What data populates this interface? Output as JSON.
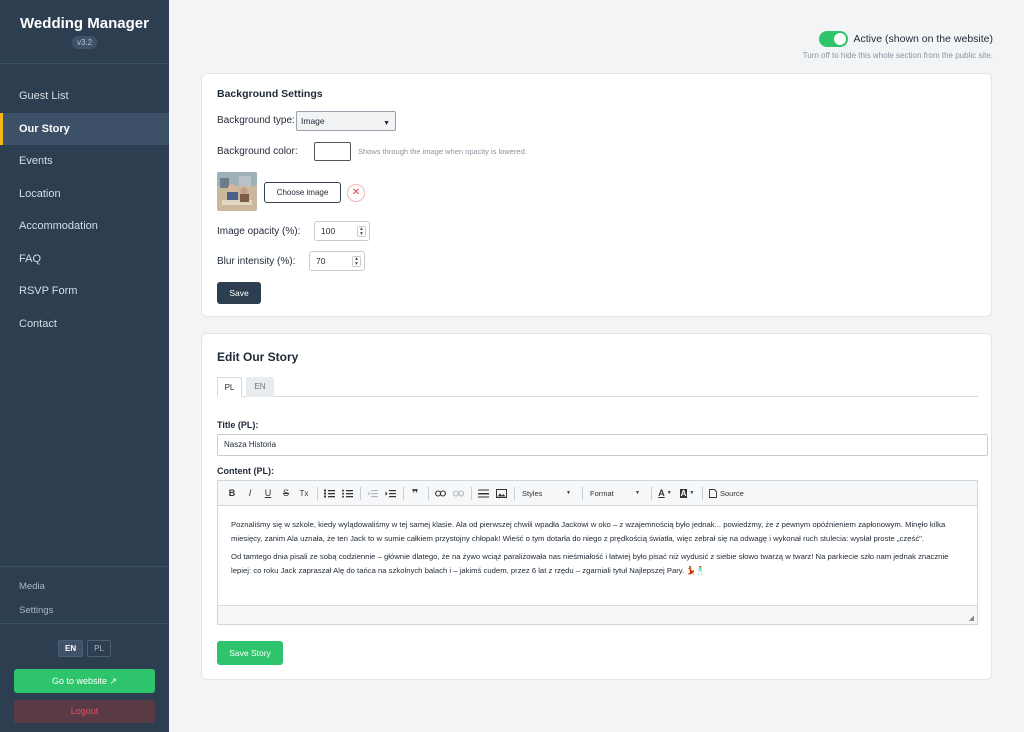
{
  "sidebar": {
    "brand_title": "Wedding Manager",
    "version": "v3.2",
    "nav_items": [
      {
        "label": "Guest List"
      },
      {
        "label": "Our Story"
      },
      {
        "label": "Events"
      },
      {
        "label": "Location"
      },
      {
        "label": "Accommodation"
      },
      {
        "label": "FAQ"
      },
      {
        "label": "RSVP Form"
      },
      {
        "label": "Contact"
      }
    ],
    "active_nav": "Our Story",
    "sub_items": [
      {
        "label": "Media"
      },
      {
        "label": "Settings"
      }
    ],
    "lang": {
      "en": "EN",
      "pl": "PL",
      "active": "EN"
    },
    "go_website_label": "Go to website ↗",
    "logout_label": "Logout"
  },
  "header": {
    "active_label": "Active (shown on the website)",
    "active_on": true,
    "active_hint": "Turn off to hide this whole section from the public site."
  },
  "background_settings": {
    "title": "Background Settings",
    "type_label": "Background type:",
    "type_value": "Image",
    "color_label": "Background color:",
    "color_value": "#ffffff",
    "color_hint": "Shows through the image when opacity is lowered.",
    "choose_image_label": "Choose image",
    "remove_icon": "✕",
    "opacity_label": "Image opacity (%):",
    "opacity_value": "100",
    "blur_label": "Blur intensity (%):",
    "blur_value": "70",
    "save_label": "Save"
  },
  "edit_story": {
    "title": "Edit Our Story",
    "tabs": [
      {
        "label": "PL"
      },
      {
        "label": "EN"
      }
    ],
    "active_tab": "PL",
    "title_field_label": "Title (PL):",
    "title_value": "Nasza Historia",
    "content_label": "Content (PL):",
    "toolbar": {
      "bold": "B",
      "italic": "I",
      "underline": "U",
      "strike": "S",
      "clear_format": "Tx",
      "styles_label": "Styles",
      "format_label": "Format",
      "source_label": "Source"
    },
    "content_paragraphs": [
      "Poznaliśmy się w szkole, kiedy wylądowaliśmy w tej samej klasie. Ala od pierwszej chwili wpadła Jackowi w oko – z wzajemnością było jednak... powiedzmy, że z pewnym opóźnieniem zapłonowym. Minęło kilka miesięcy, zanim Ala uznała, że ten Jack to w sumie całkiem przystojny chłopak! Wieść o tym dotarła do niego z prędkością światła, więc zebrał się na odwagę i wykonał ruch stulecia: wysłał proste „cześć\".",
      "Od tamtego dnia pisali ze sobą codziennie – głównie dlatego, że na żywo wciąż paraliżowała nas nieśmiałość i łatwiej było pisać niż wydusić z siebie słowo twarzą w twarz! Na parkiecie szło nam jednak znacznie lepiej: co roku Jack zapraszał Alę do tańca na szkolnych balach i – jakimś cudem, przez 6 lat z rzędu – zgarniali tytuł Najlepszej Pary. 💃🕺"
    ],
    "save_story_label": "Save Story"
  },
  "colors": {
    "sidebar_bg": "#2d3e50",
    "accent_yellow": "#f2b61a",
    "green": "#2ec46b",
    "dark_button": "#2d3e50"
  }
}
